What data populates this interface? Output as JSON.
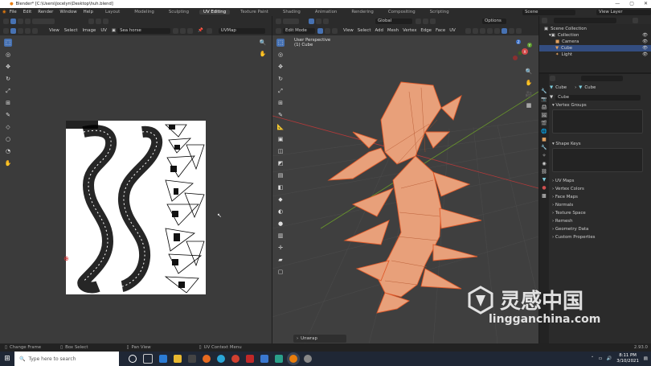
{
  "window": {
    "title": "Blender* [C:\\Users\\Jocelyn\\Desktop\\huh.blend]",
    "controls": [
      "—",
      "▢",
      "✕"
    ]
  },
  "menu": {
    "items": [
      "File",
      "Edit",
      "Render",
      "Window",
      "Help"
    ]
  },
  "workspaces": [
    "Layout",
    "Modeling",
    "Sculpting",
    "UV Editing",
    "Texture Paint",
    "Shading",
    "Animation",
    "Rendering",
    "Compositing",
    "Scripting"
  ],
  "active_workspace": "UV Editing",
  "scene": {
    "label": "Scene",
    "view_layer": "View Layer"
  },
  "uv_editor": {
    "menus": [
      "View",
      "Select",
      "Image",
      "UV"
    ],
    "image_name": "Sea horse",
    "uvmap": "UVMap"
  },
  "viewport": {
    "mode": "Edit Mode",
    "menus": [
      "View",
      "Select",
      "Add",
      "Mesh",
      "Vertex",
      "Edge",
      "Face",
      "UV"
    ],
    "orientation": "Global",
    "options": "Options",
    "overlay_title": "User Perspective",
    "overlay_object": "(1) Cube",
    "last_op": "Unwrap",
    "axes": [
      "X",
      "Y",
      "Z"
    ]
  },
  "outliner": {
    "items": [
      {
        "label": "Scene Collection",
        "indent": 0
      },
      {
        "label": "Collection",
        "indent": 1
      },
      {
        "label": "Camera",
        "indent": 2
      },
      {
        "label": "Cube",
        "indent": 2,
        "selected": true
      },
      {
        "label": "Light",
        "indent": 2
      }
    ]
  },
  "properties": {
    "object": "Cube",
    "mesh": "Cube",
    "data_name": "Cube",
    "sections": [
      "Vertex Groups",
      "Shape Keys",
      "UV Maps",
      "Vertex Colors",
      "Face Maps",
      "Normals",
      "Texture Space",
      "Remesh",
      "Geometry Data",
      "Custom Properties"
    ]
  },
  "status": {
    "items": [
      "Change Frame",
      "Box Select",
      "Pan View",
      "UV Context Menu"
    ],
    "version": "2.93.0"
  },
  "taskbar": {
    "search_placeholder": "Type here to search",
    "time": "8:11 PM",
    "date": "3/10/2021"
  },
  "watermark": {
    "cn": "灵感中国",
    "url": "lingganchina.com"
  },
  "colors": {
    "accent": "#4772b3",
    "mesh": "#e8a07a",
    "mesh_edge": "#e05a2a",
    "uv_bg": "#ffffff"
  }
}
